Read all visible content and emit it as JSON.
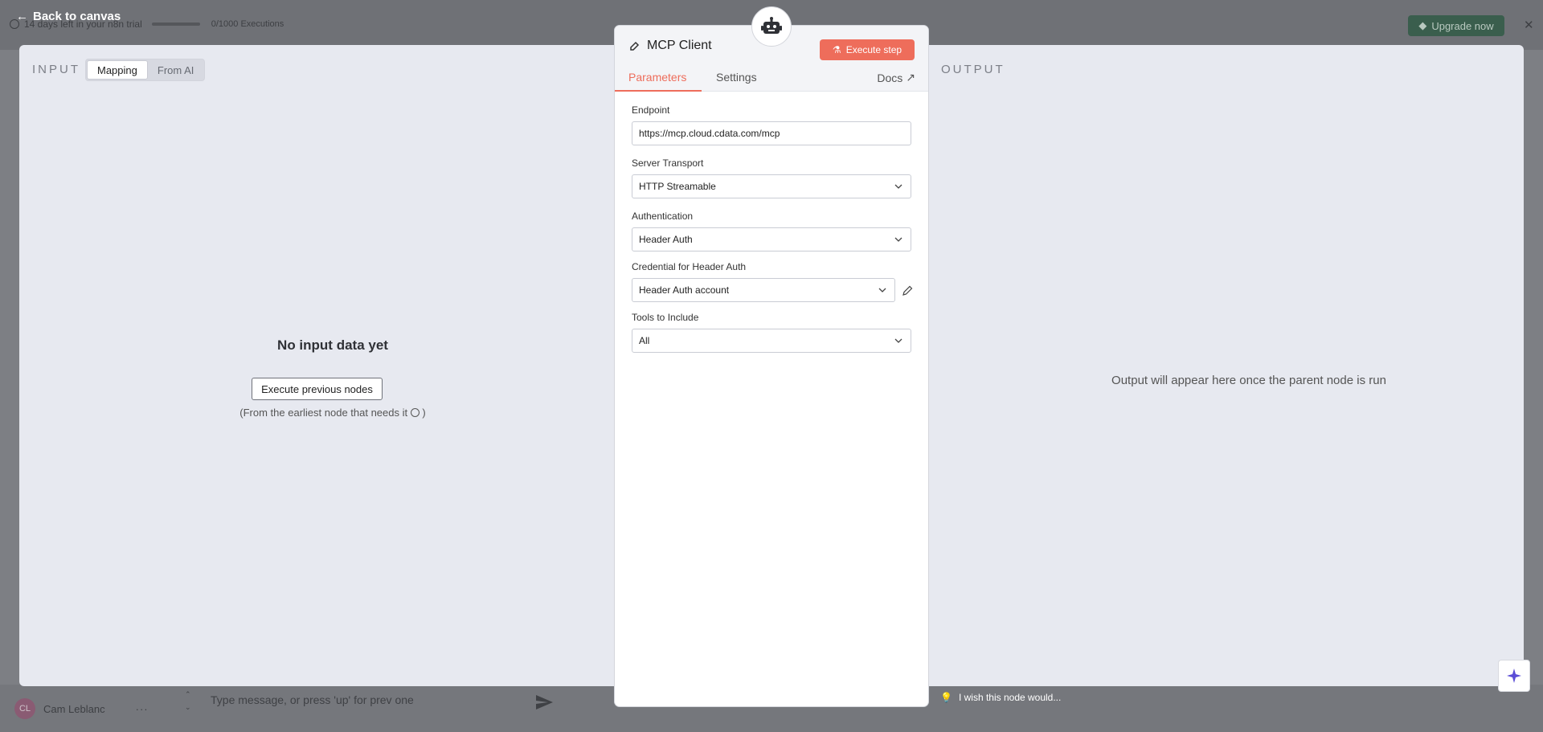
{
  "background": {
    "trial_text": "14 days left in your n8n trial",
    "executions": "0/1000 Executions",
    "upgrade_label": "Upgrade now",
    "user_initials": "CL",
    "user_name": "Cam Leblanc",
    "chat_placeholder": "Type message, or press 'up' for prev one"
  },
  "nav": {
    "back_label": "Back to canvas"
  },
  "input_pane": {
    "title": "INPUT",
    "tabs": [
      {
        "label": "Mapping",
        "active": true
      },
      {
        "label": "From AI",
        "active": false
      }
    ],
    "empty_title": "No input data yet",
    "execute_prev_label": "Execute previous nodes",
    "hint_prefix": "(From the earliest node that needs it",
    "hint_suffix": ")"
  },
  "node": {
    "icon": "robot-icon",
    "title": "MCP Client",
    "execute_label": "Execute step",
    "tabs": [
      {
        "label": "Parameters",
        "active": true
      },
      {
        "label": "Settings",
        "active": false
      }
    ],
    "docs_label": "Docs",
    "fields": {
      "endpoint": {
        "label": "Endpoint",
        "value": "https://mcp.cloud.cdata.com/mcp"
      },
      "transport": {
        "label": "Server Transport",
        "value": "HTTP Streamable"
      },
      "auth": {
        "label": "Authentication",
        "value": "Header Auth"
      },
      "credential": {
        "label": "Credential for Header Auth",
        "value": "Header Auth account"
      },
      "tools": {
        "label": "Tools to Include",
        "value": "All"
      }
    },
    "accent_color": "#ee6d5b"
  },
  "output_pane": {
    "title": "OUTPUT",
    "empty_message": "Output will appear here once the parent node is run"
  },
  "feedback": {
    "label": "I wish this node would..."
  }
}
